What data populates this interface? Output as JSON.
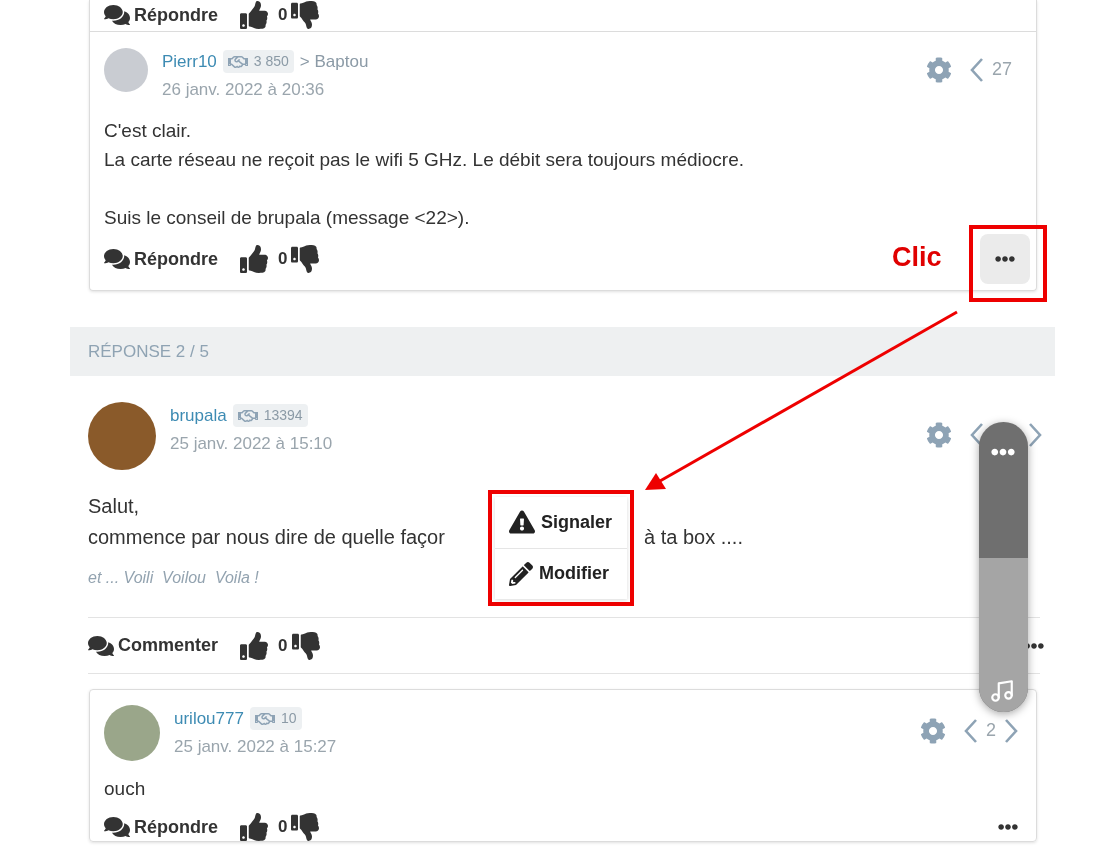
{
  "previous_footer": {
    "reply_label": "Répondre",
    "likes": "0"
  },
  "reply_card": {
    "author": "Pierr10",
    "reputation": "3 850",
    "reply_to": "> Baptou",
    "date": "26 janv. 2022 à 20:36",
    "nav": {
      "count": "27",
      "next": false
    },
    "paragraphs": [
      [
        "C'est clair.",
        "La carte réseau ne reçoit pas le wifi 5 GHz. Le débit sera toujours médiocre."
      ],
      [
        "Suis le conseil de brupala (message <22>)."
      ]
    ],
    "reply_label": "Répondre",
    "likes": "0"
  },
  "section": {
    "label": "RÉPONSE 2 / 5"
  },
  "post": {
    "author": "brupala",
    "reputation": "13394",
    "date": "25 janv. 2022 à 15:10",
    "nav": {
      "next": true
    },
    "greeting": "Salut,",
    "line_start": "commence par nous dire de quelle façor",
    "line_end": "à ta box ....",
    "signature": "et ... Voili  Voilou  Voila !",
    "comment_label": "Commenter",
    "likes": "0"
  },
  "nested_reply": {
    "author": "urilou777",
    "reputation": "10",
    "date": "25 janv. 2022 à 15:27",
    "nav": {
      "count": "2",
      "next": true
    },
    "body": "ouch",
    "reply_label": "Répondre",
    "likes": "0"
  },
  "menu": {
    "items": [
      {
        "kind": "report",
        "label": "Signaler"
      },
      {
        "kind": "edit",
        "label": "Modifier"
      }
    ]
  },
  "annotation": {
    "label": "Clic"
  },
  "volume_slider": {
    "level": 0.53
  }
}
